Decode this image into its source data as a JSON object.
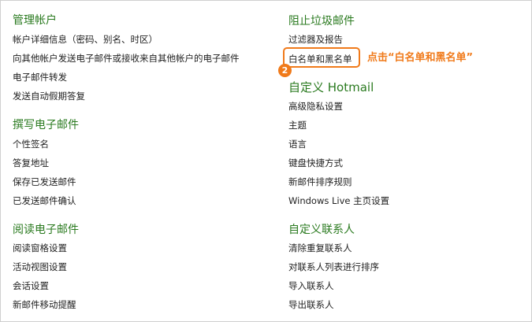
{
  "sections": {
    "manage_account": {
      "title": "管理帐户",
      "links": [
        "帐户详细信息（密码、别名、时区）",
        "向其他帐户发送电子邮件或接收来自其他帐户的电子邮件",
        "电子邮件转发",
        "发送自动假期答复"
      ]
    },
    "write_email": {
      "title": "撰写电子邮件",
      "links": [
        "个性签名",
        "答复地址",
        "保存已发送邮件",
        "已发送邮件确认"
      ]
    },
    "read_email": {
      "title": "阅读电子邮件",
      "links": [
        "阅读窗格设置",
        "活动视图设置",
        "会话设置",
        "新邮件移动提醒"
      ]
    },
    "block_junk": {
      "title": "阻止垃圾邮件",
      "links": [
        "过滤器及报告",
        "白名单和黑名单"
      ]
    },
    "customize_hotmail": {
      "title": "自定义 Hotmail",
      "links": [
        "高级隐私设置",
        "主题",
        "语言",
        "键盘快捷方式",
        "新邮件排序规则",
        "Windows Live 主页设置"
      ]
    },
    "customize_contacts": {
      "title": "自定义联系人",
      "links": [
        "清除重复联系人",
        "对联系人列表进行排序",
        "导入联系人",
        "导出联系人"
      ]
    }
  },
  "annotation": {
    "badge_number": "2",
    "callout_text": "点击“白名单和黑名单”",
    "accent_color": "#f07a1a"
  },
  "colors": {
    "section_title": "#2a7a1f",
    "link_text": "#222222"
  }
}
